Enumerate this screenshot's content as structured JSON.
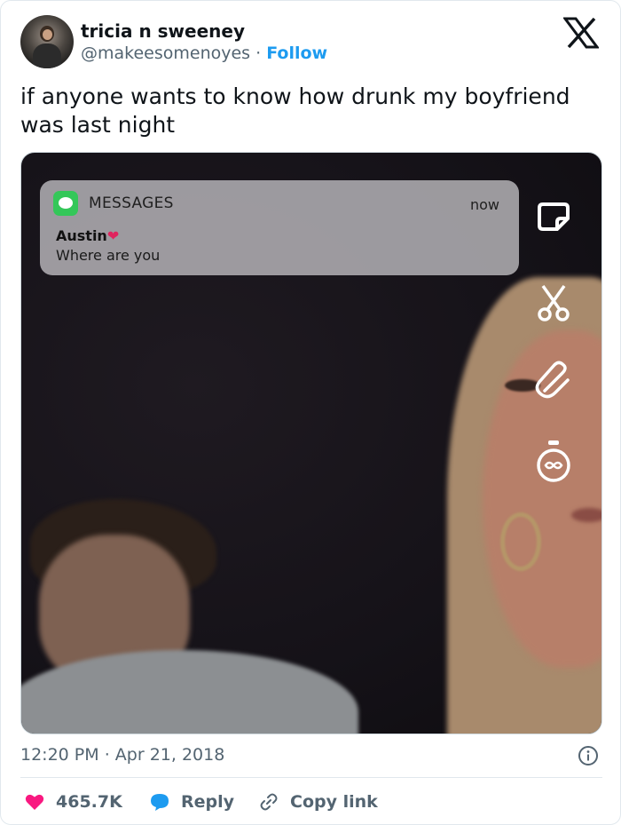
{
  "author": {
    "name": "tricia n sweeney",
    "handle": "@makeesomenoyes",
    "separator": "·",
    "follow_label": "Follow"
  },
  "tweet": {
    "text": "if anyone wants to know how drunk my boyfriend was last night"
  },
  "notification": {
    "app": "MESSAGES",
    "time": "now",
    "sender": "Austin",
    "sender_emoji": "❤",
    "body": "Where are you"
  },
  "meta": {
    "time": "12:20 PM",
    "separator": "·",
    "date": "Apr 21, 2018"
  },
  "actions": {
    "likes": "465.7K",
    "reply_label": "Reply",
    "copy_label": "Copy link"
  },
  "colors": {
    "accent": "#1d9bf0",
    "like": "#f91880",
    "messages_green": "#34c759"
  },
  "icons": {
    "platform": "x-logo-icon",
    "sticker": "sticker-icon",
    "scissors": "scissors-icon",
    "paperclip": "paperclip-icon",
    "timer": "timer-icon",
    "info": "info-icon",
    "like": "heart-icon",
    "reply": "speech-bubble-icon",
    "copy": "link-icon"
  }
}
